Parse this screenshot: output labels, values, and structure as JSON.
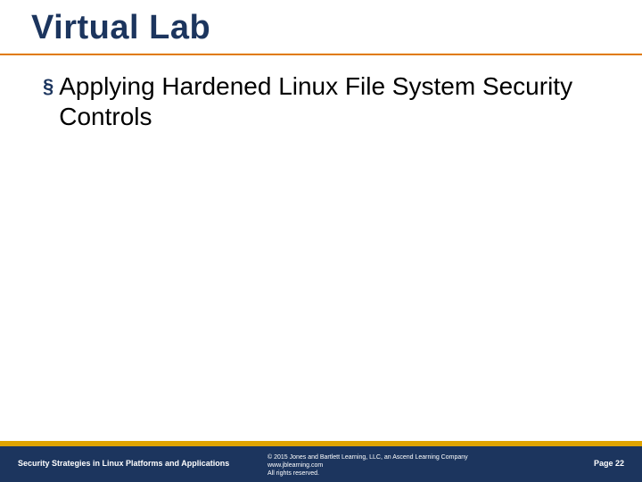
{
  "title": "Virtual Lab",
  "bullets": [
    {
      "marker": "§",
      "text": "Applying Hardened Linux File System Security Controls"
    }
  ],
  "footer": {
    "left": "Security Strategies in Linux Platforms and Applications",
    "center": {
      "line1": "© 2015 Jones and Bartlett Learning, LLC, an Ascend Learning Company",
      "line2": "www.jblearning.com",
      "line3": "All rights reserved."
    },
    "right": "Page 22"
  }
}
